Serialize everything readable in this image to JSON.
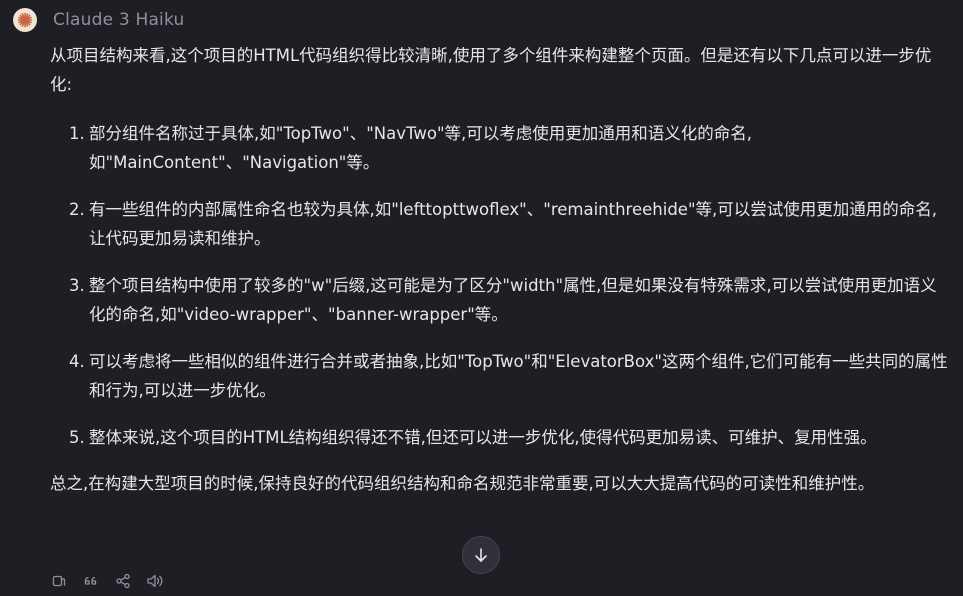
{
  "header": {
    "model_name": "Claude 3 Haiku",
    "avatar_icon": "claude-sunburst-icon",
    "avatar_color": "#c96442"
  },
  "message": {
    "intro": "从项目结构来看,这个项目的HTML代码组织得比较清晰,使用了多个组件来构建整个页面。但是还有以下几点可以进一步优化:",
    "items": [
      {
        "num": "1.",
        "text": "部分组件名称过于具体,如\"TopTwo\"、\"NavTwo\"等,可以考虑使用更加通用和语义化的命名,如\"MainContent\"、\"Navigation\"等。"
      },
      {
        "num": "2.",
        "text": "有一些组件的内部属性命名也较为具体,如\"lefttopttwoflex\"、\"remainthreehide\"等,可以尝试使用更加通用的命名,让代码更加易读和维护。"
      },
      {
        "num": "3.",
        "text": "整个项目结构中使用了较多的\"w\"后缀,这可能是为了区分\"width\"属性,但是如果没有特殊需求,可以尝试使用更加语义化的命名,如\"video-wrapper\"、\"banner-wrapper\"等。"
      },
      {
        "num": "4.",
        "text": "可以考虑将一些相似的组件进行合并或者抽象,比如\"TopTwo\"和\"ElevatorBox\"这两个组件,它们可能有一些共同的属性和行为,可以进一步优化。"
      },
      {
        "num": "5.",
        "text": "整体来说,这个项目的HTML结构组织得还不错,但还可以进一步优化,使得代码更加易读、可维护、复用性强。"
      }
    ],
    "outro": "总之,在构建大型项目的时候,保持良好的代码组织结构和命名规范非常重要,可以大大提高代码的可读性和维护性。"
  },
  "actions": [
    {
      "name": "copy-icon"
    },
    {
      "name": "quote-icon"
    },
    {
      "name": "share-icon"
    },
    {
      "name": "speaker-icon"
    }
  ],
  "scroll_button": {
    "icon": "arrow-down-icon"
  },
  "colors": {
    "background": "#1e1f25",
    "text": "#e6e6ea",
    "muted": "#8f909a"
  }
}
